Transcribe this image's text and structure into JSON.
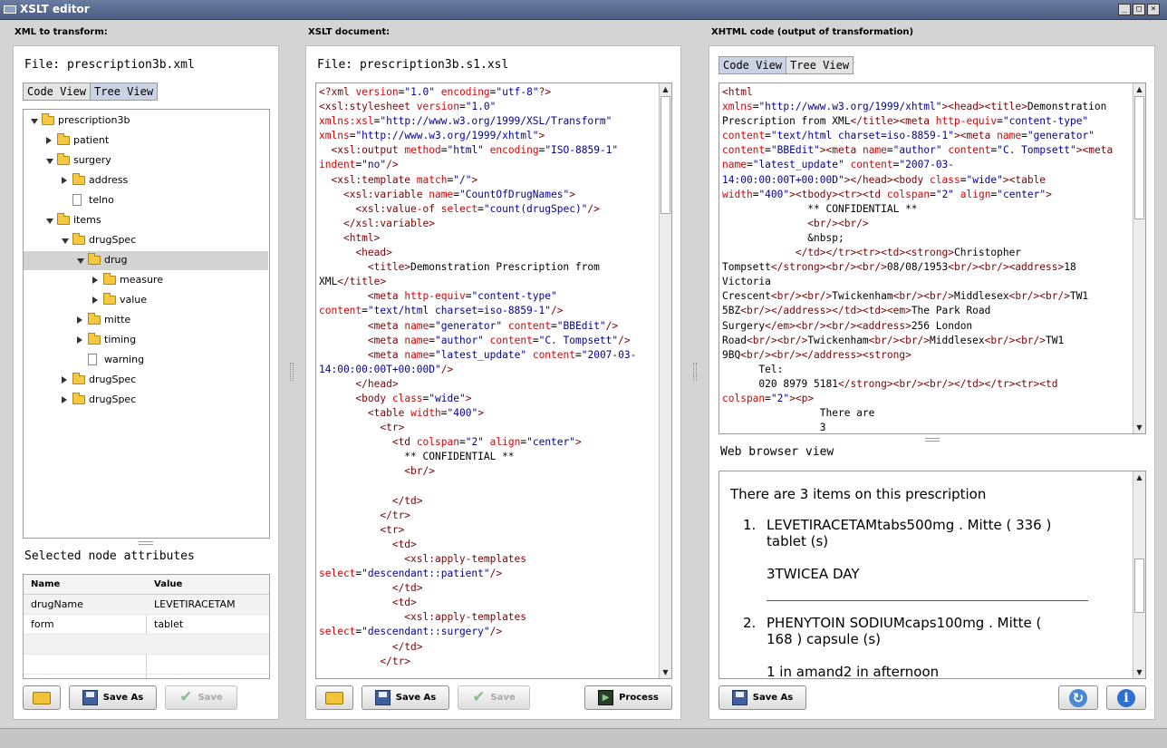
{
  "window": {
    "title": "XSLT editor",
    "controls": [
      "_",
      "□",
      "×"
    ]
  },
  "left": {
    "header": "XML to transform:",
    "file_label": "File: prescription3b.xml",
    "tabs": [
      {
        "label": "Code View"
      },
      {
        "label": "Tree View"
      }
    ],
    "tree": [
      {
        "label": "prescription3b",
        "depth": 0,
        "expander": "open",
        "icon": "folder-open-icon"
      },
      {
        "label": "patient",
        "depth": 1,
        "expander": "closed",
        "icon": "folder-icon"
      },
      {
        "label": "surgery",
        "depth": 1,
        "expander": "open",
        "icon": "folder-icon"
      },
      {
        "label": "address",
        "depth": 2,
        "expander": "closed",
        "icon": "folder-icon"
      },
      {
        "label": "telno",
        "depth": 2,
        "expander": "none",
        "icon": "file-icon"
      },
      {
        "label": "items",
        "depth": 1,
        "expander": "open",
        "icon": "folder-icon"
      },
      {
        "label": "drugSpec",
        "depth": 2,
        "expander": "open",
        "icon": "folder-icon"
      },
      {
        "label": "drug",
        "depth": 3,
        "expander": "open",
        "icon": "folder-open-icon"
      },
      {
        "label": "measure",
        "depth": 4,
        "expander": "closed",
        "icon": "folder-icon"
      },
      {
        "label": "value",
        "depth": 4,
        "expander": "closed",
        "icon": "folder-icon"
      },
      {
        "label": "mitte",
        "depth": 3,
        "expander": "closed",
        "icon": "folder-icon"
      },
      {
        "label": "timing",
        "depth": 3,
        "expander": "closed",
        "icon": "folder-icon"
      },
      {
        "label": "warning",
        "depth": 3,
        "expander": "none",
        "icon": "file-icon"
      },
      {
        "label": "drugSpec",
        "depth": 2,
        "expander": "closed",
        "icon": "folder-icon"
      },
      {
        "label": "drugSpec",
        "depth": 2,
        "expander": "closed",
        "icon": "folder-icon"
      }
    ],
    "selected_tree_row": 7,
    "attributes_title": "Selected node attributes",
    "attr_headers": {
      "name": "Name",
      "value": "Value"
    },
    "attributes": [
      {
        "name": "drugName",
        "value": "LEVETIRACETAM"
      },
      {
        "name": "form",
        "value": "tablet"
      },
      {
        "name": "",
        "value": ""
      },
      {
        "name": "",
        "value": ""
      }
    ],
    "buttons": {
      "save_as": "Save As",
      "save": "Save"
    }
  },
  "middle": {
    "header": "XSLT document:",
    "file_label": "File: prescription3b.s1.xsl",
    "buttons": {
      "save_as": "Save As",
      "save": "Save",
      "process": "Process"
    }
  },
  "right": {
    "header": "XHTML code (output of transformation)",
    "tabs": [
      {
        "label": "Code View"
      },
      {
        "label": "Tree View"
      }
    ],
    "browser_label": "Web browser view",
    "browser_intro": "There are 3 items on this prescription",
    "browser_items": [
      {
        "num": "1.",
        "line1": "LEVETIRACETAMtabs500mg . Mitte ( 336 )",
        "line2": "tablet (s)",
        "line3": "3TWICEA DAY"
      },
      {
        "num": "2.",
        "line1": "PHENYTOIN SODIUMcaps100mg . Mitte (",
        "line2": "168 ) capsule (s)",
        "line3": "1 in amand2 in afternoon"
      }
    ],
    "buttons": {
      "save_as": "Save As"
    }
  },
  "colors": {
    "titlebar": "#4a5d82",
    "selected_row": "#d3d3d3",
    "tag": "#800000",
    "attr": "#e00000",
    "value": "#0000a0"
  }
}
